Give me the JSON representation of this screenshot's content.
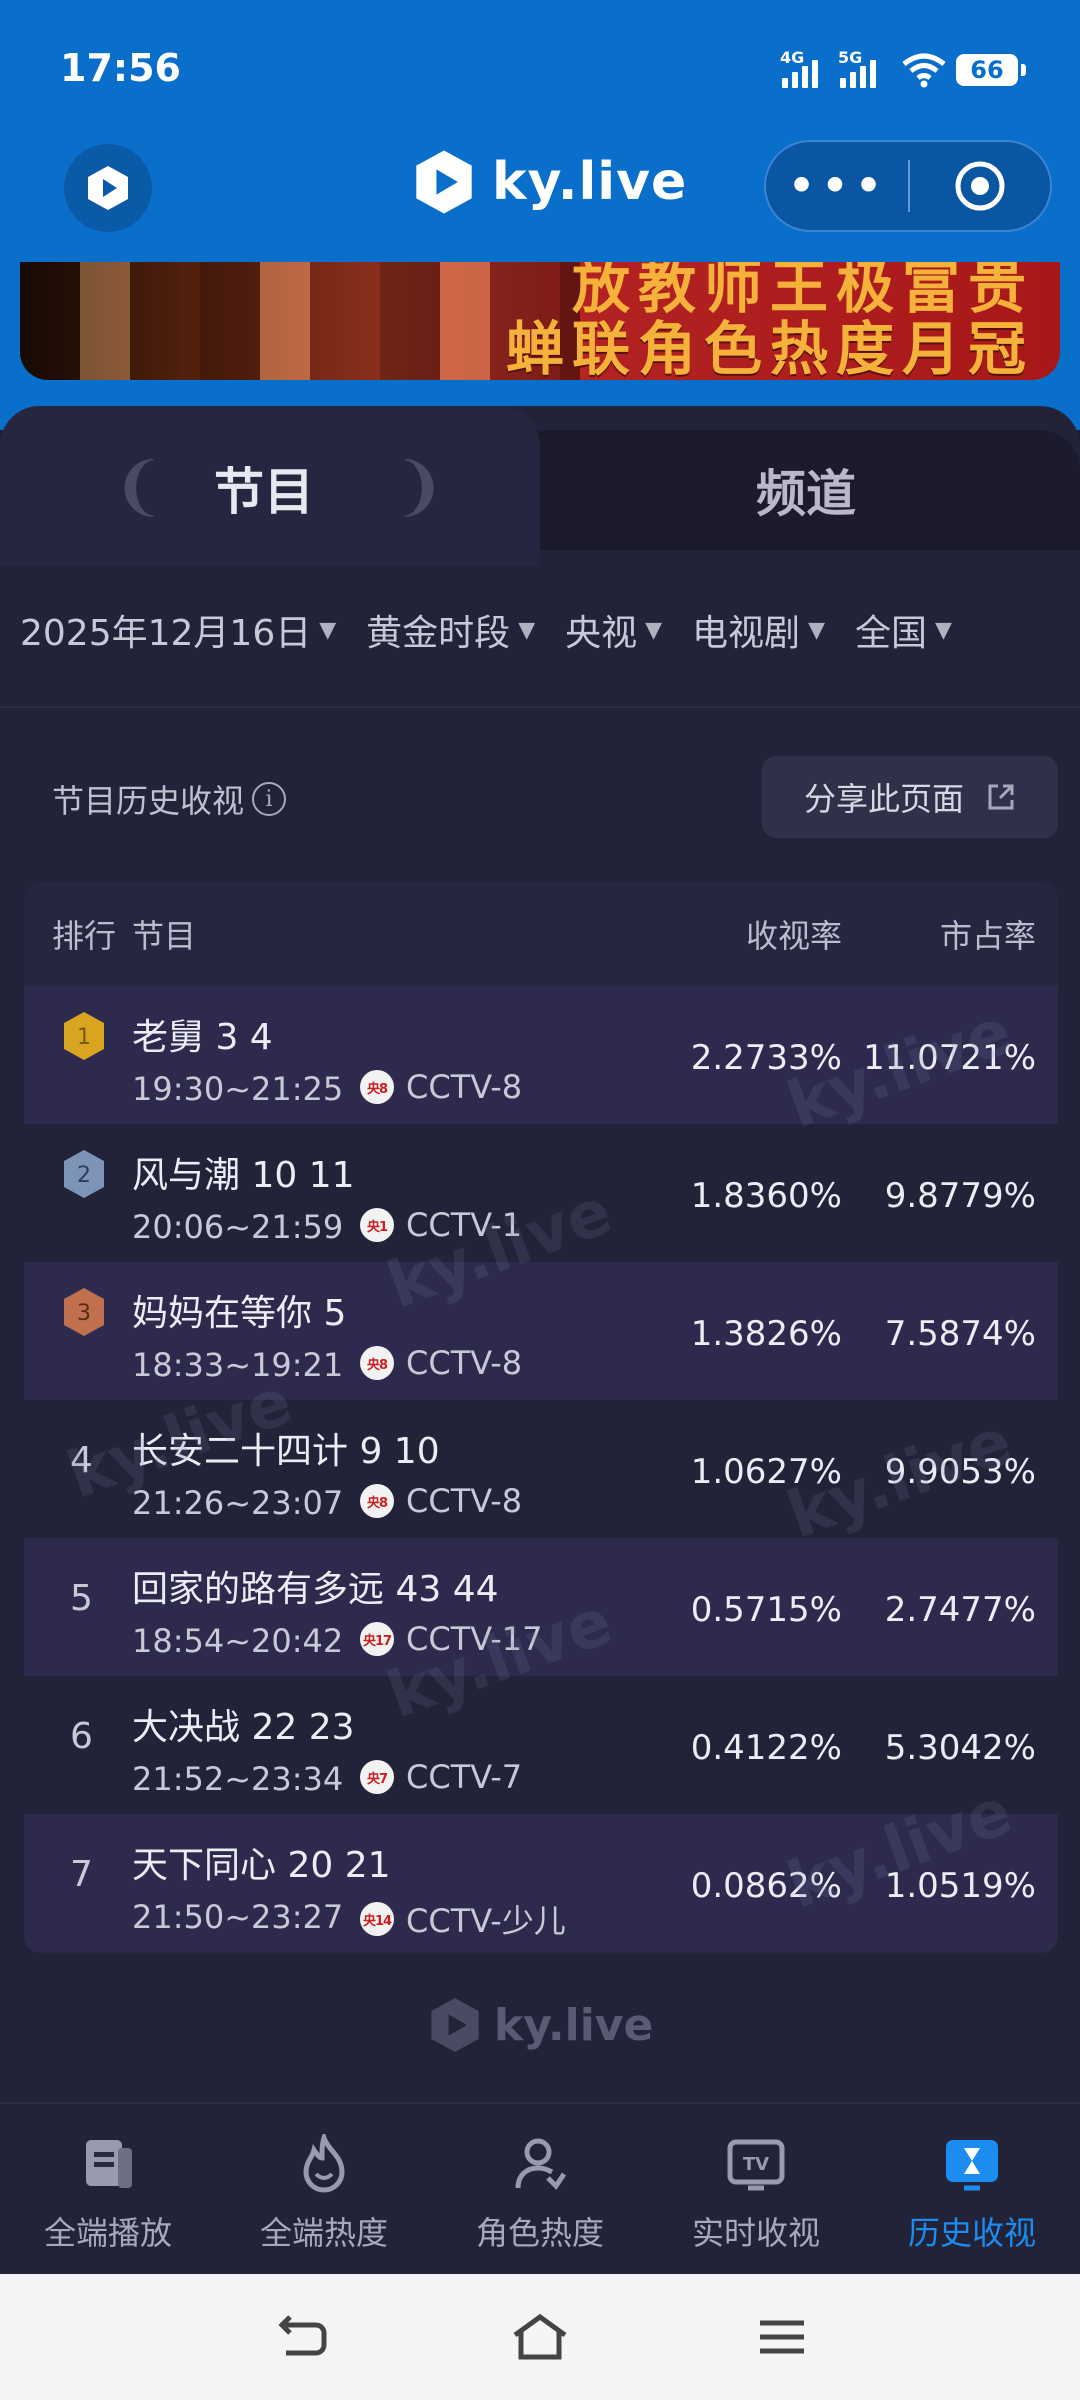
{
  "status": {
    "time": "17:56",
    "net1": "4G",
    "net2": "5G",
    "battery": "66"
  },
  "header": {
    "brand": "ky.live"
  },
  "banner": {
    "line1": "放教师王极富贵",
    "line2": "蝉联角色热度月冠"
  },
  "tabs": [
    {
      "label": "节目",
      "active": true
    },
    {
      "label": "频道",
      "active": false
    }
  ],
  "filters": [
    {
      "label": "2025年12月16日"
    },
    {
      "label": "黄金时段"
    },
    {
      "label": "央视"
    },
    {
      "label": "电视剧"
    },
    {
      "label": "全国"
    }
  ],
  "section": {
    "title": "节目历史收视",
    "share_label": "分享此页面"
  },
  "table": {
    "headers": {
      "rank": "排行",
      "program": "节目",
      "rating": "收视率",
      "share": "市占率"
    },
    "rows": [
      {
        "rank": "1",
        "title": "老舅 3 4",
        "time": "19:30~21:25",
        "badge": "央8",
        "channel": "CCTV-8",
        "rating": "2.2733%",
        "share": "11.0721%"
      },
      {
        "rank": "2",
        "title": "风与潮 10 11",
        "time": "20:06~21:59",
        "badge": "央1",
        "channel": "CCTV-1",
        "rating": "1.8360%",
        "share": "9.8779%"
      },
      {
        "rank": "3",
        "title": "妈妈在等你 5",
        "time": "18:33~19:21",
        "badge": "央8",
        "channel": "CCTV-8",
        "rating": "1.3826%",
        "share": "7.5874%"
      },
      {
        "rank": "4",
        "title": "长安二十四计 9 10",
        "time": "21:26~23:07",
        "badge": "央8",
        "channel": "CCTV-8",
        "rating": "1.0627%",
        "share": "9.9053%"
      },
      {
        "rank": "5",
        "title": "回家的路有多远 43 44",
        "time": "18:54~20:42",
        "badge": "央17",
        "channel": "CCTV-17",
        "rating": "0.5715%",
        "share": "2.7477%"
      },
      {
        "rank": "6",
        "title": "大决战 22 23",
        "time": "21:52~23:34",
        "badge": "央7",
        "channel": "CCTV-7",
        "rating": "0.4122%",
        "share": "5.3042%"
      },
      {
        "rank": "7",
        "title": "天下同心 20 21",
        "time": "21:50~23:27",
        "badge": "央14",
        "channel": "CCTV-少儿",
        "rating": "0.0862%",
        "share": "1.0519%"
      }
    ]
  },
  "footer": {
    "brand": "ky.live"
  },
  "nav": [
    {
      "label": "全端播放",
      "icon": "playback-icon"
    },
    {
      "label": "全端热度",
      "icon": "flame-icon"
    },
    {
      "label": "角色热度",
      "icon": "person-icon"
    },
    {
      "label": "实时收视",
      "icon": "tv-icon"
    },
    {
      "label": "历史收视",
      "icon": "history-icon",
      "active": true
    }
  ],
  "colors": {
    "top_bg": "#0a6ecb",
    "panel_bg": "#222238",
    "accent": "#1d8cf0",
    "gold": "#d9a520",
    "silver": "#7d94b8",
    "bronze": "#c0704e"
  }
}
